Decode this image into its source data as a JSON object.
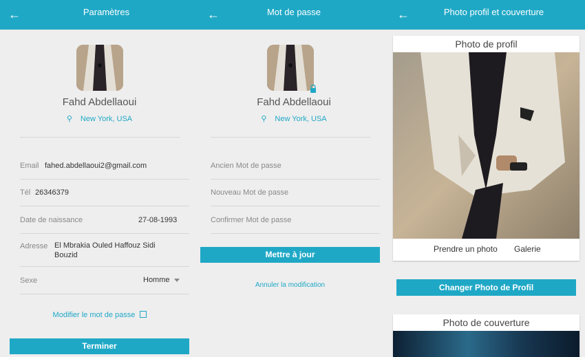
{
  "settings": {
    "title": "Paramètres",
    "name": "Fahd Abdellaoui",
    "location": "New York, USA",
    "email_label": "Email",
    "email_value": "fahed.abdellaoui2@gmail.com",
    "tel_label": "Tél",
    "tel_value": "26346379",
    "dob_label": "Date de naissance",
    "dob_value": "27-08-1993",
    "address_label": "Adresse",
    "address_line1": "El Mbrakia Ouled Haffouz Sidi",
    "address_line2": "Bouzid",
    "sex_label": "Sexe",
    "sex_value": "Homme",
    "change_password_link": "Modifier le mot de passe",
    "finish_button": "Terminer"
  },
  "password": {
    "title": "Mot de passe",
    "name": "Fahd Abdellaoui",
    "location": "New York, USA",
    "old_placeholder": "Ancien Mot de passe",
    "new_placeholder": "Nouveau Mot de passe",
    "confirm_placeholder": "Confirmer Mot de passe",
    "update_button": "Mettre à jour",
    "cancel_link": "Annuler la modification"
  },
  "photos": {
    "title": "Photo profil et couverture",
    "profile_card_title": "Photo de profil",
    "take_photo_button": "Prendre un photo",
    "gallery_button": "Galerie",
    "change_profile_button": "Changer Photo de Profil",
    "cover_card_title": "Photo de couverture"
  },
  "icons": {
    "back": "arrow-left-icon",
    "pin": "map-pin-icon",
    "edit": "edit-icon",
    "lock": "lock-icon",
    "dropdown": "caret-down-icon"
  },
  "colors": {
    "accent": "#1fa8c6",
    "background": "#eeeeee"
  }
}
